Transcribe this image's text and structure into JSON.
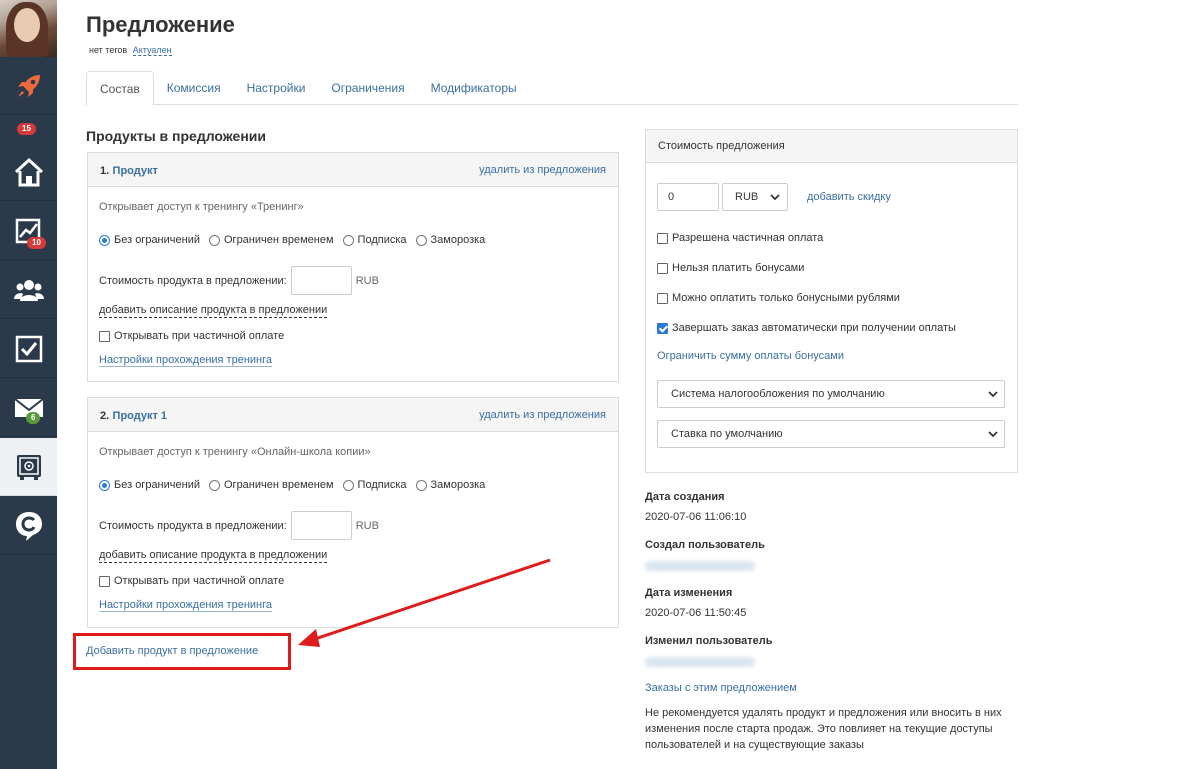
{
  "header": {
    "title": "Предложение",
    "tags": "нет тегов",
    "status": "Актуален"
  },
  "sidebar": {
    "badges": {
      "rocket": "15",
      "chart": "10",
      "mail": "6"
    },
    "items": [
      {
        "icon": "rocket-icon"
      },
      {
        "icon": "home-icon"
      },
      {
        "icon": "chart-icon"
      },
      {
        "icon": "users-icon"
      },
      {
        "icon": "tasks-icon"
      },
      {
        "icon": "mail-icon"
      },
      {
        "icon": "safe-icon"
      },
      {
        "icon": "logo-icon"
      }
    ]
  },
  "tabs": [
    {
      "label": "Состав",
      "active": true
    },
    {
      "label": "Комиссия"
    },
    {
      "label": "Настройки"
    },
    {
      "label": "Ограничения"
    },
    {
      "label": "Модификаторы"
    }
  ],
  "products_section": {
    "title": "Продукты в предложении",
    "remove_label": "удалить из предложения",
    "radio_options": [
      "Без ограничений",
      "Ограничен временем",
      "Подписка",
      "Заморозка"
    ],
    "cost_label": "Стоимость продукта в предложении:",
    "currency": "RUB",
    "add_description": "добавить описание продукта в предложении",
    "partial_payment": "Открывать при частичной оплате",
    "training_settings": "Настройки прохождения тренинга",
    "products": [
      {
        "num": "1.",
        "name": "Продукт",
        "access": "Открывает доступ к тренингу «Тренинг»",
        "selected": "Без ограничений"
      },
      {
        "num": "2.",
        "name": "Продукт 1",
        "access": "Открывает доступ к тренингу «Онлайн-школа копии»",
        "selected": "Без ограничений"
      }
    ],
    "add_product": "Добавить продукт в предложение"
  },
  "cost_panel": {
    "title": "Стоимость предложения",
    "value": "0",
    "currency": "RUB",
    "add_discount": "добавить скидку",
    "checkboxes": [
      {
        "label": "Разрешена частичная оплата",
        "checked": false
      },
      {
        "label": "Нельзя платить бонусами",
        "checked": false
      },
      {
        "label": "Можно оплатить только бонусными рублями",
        "checked": false
      },
      {
        "label": "Завершать заказ автоматически при получении оплаты",
        "checked": true
      }
    ],
    "limit_bonus": "Ограничить сумму оплаты бонусами",
    "tax_system": "Система налогообложения по умолчанию",
    "rate": "Ставка по умолчанию"
  },
  "meta": {
    "created_label": "Дата создания",
    "created_value": "2020-07-06 11:06:10",
    "created_by_label": "Создал пользователь",
    "modified_label": "Дата изменения",
    "modified_value": "2020-07-06 11:50:45",
    "modified_by_label": "Изменил пользователь",
    "orders_link": "Заказы с этим предложением",
    "warning": "Не рекомендуется удалять продукт и предложения или вносить в них изменения после старта продаж. Это повлияет на текущие доступы пользователей и на существующие заказы"
  },
  "colors": {
    "sidebar": "#2b3a4a",
    "link": "#3b6fa0",
    "highlight": "#e01b1b",
    "rocket": "#f06a3c"
  }
}
